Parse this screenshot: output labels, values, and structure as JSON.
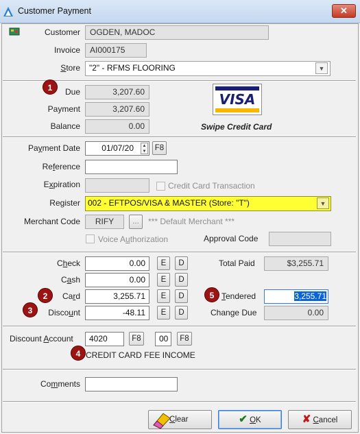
{
  "window": {
    "title": "Customer Payment",
    "close_glyph": "✕"
  },
  "header": {
    "customer_label": "Customer",
    "customer_value": "OGDEN, MADOC",
    "invoice_label": "Invoice",
    "invoice_value": "AI000175",
    "store_label": "Store",
    "store_value": "\"2\" - RFMS FLOORING"
  },
  "balance": {
    "due_label": "Due",
    "due_value": "3,207.60",
    "payment_label": "Payment",
    "payment_value": "3,207.60",
    "balance_label": "Balance",
    "balance_value": "0.00",
    "card_logo": "VISA",
    "swipe_label": "Swipe Credit Card"
  },
  "payment": {
    "date_label": "Payment Date",
    "date_value": "01/07/20",
    "f8": "F8",
    "reference_label": "Reference",
    "reference_value": "",
    "expiration_label": "Expiration",
    "expiration_value": "",
    "cc_transaction_label": "Credit Card Transaction",
    "register_label": "Register",
    "register_value": "002 - EFTPOS/VISA & MASTER (Store: \"T\")",
    "merchant_label": "Merchant Code",
    "merchant_value": "RIFY",
    "merchant_btn": "...",
    "merchant_default": "*** Default Merchant ***",
    "voice_auth_label": "Voice Authorization",
    "approval_label": "Approval Code",
    "approval_value": ""
  },
  "tenders": {
    "check_label": "Check",
    "check_value": "0.00",
    "cash_label": "Cash",
    "cash_value": "0.00",
    "card_label": "Card",
    "card_value": "3,255.71",
    "discount_label": "Discount",
    "discount_value": "-48.11",
    "e": "E",
    "d": "D",
    "total_paid_label": "Total Paid",
    "total_paid_value": "$3,255.71",
    "tendered_label": "Tendered",
    "tendered_value": "3,255.71",
    "change_due_label": "Change Due",
    "change_due_value": "0.00"
  },
  "discount_account": {
    "label": "Discount Account",
    "account": "4020",
    "f8": "F8",
    "sub": "00",
    "f8b": "F8",
    "description": "CREDIT CARD FEE INCOME"
  },
  "comments": {
    "label": "Comments",
    "value": ""
  },
  "badges": {
    "b1": "1",
    "b2": "2",
    "b3": "3",
    "b4": "4",
    "b5": "5"
  },
  "footer": {
    "clear": "Clear",
    "ok": "OK",
    "cancel": "Cancel"
  },
  "colors": {
    "register_highlight": "#ffff33",
    "badge": "#9b1414",
    "selection": "#0a64d6"
  }
}
